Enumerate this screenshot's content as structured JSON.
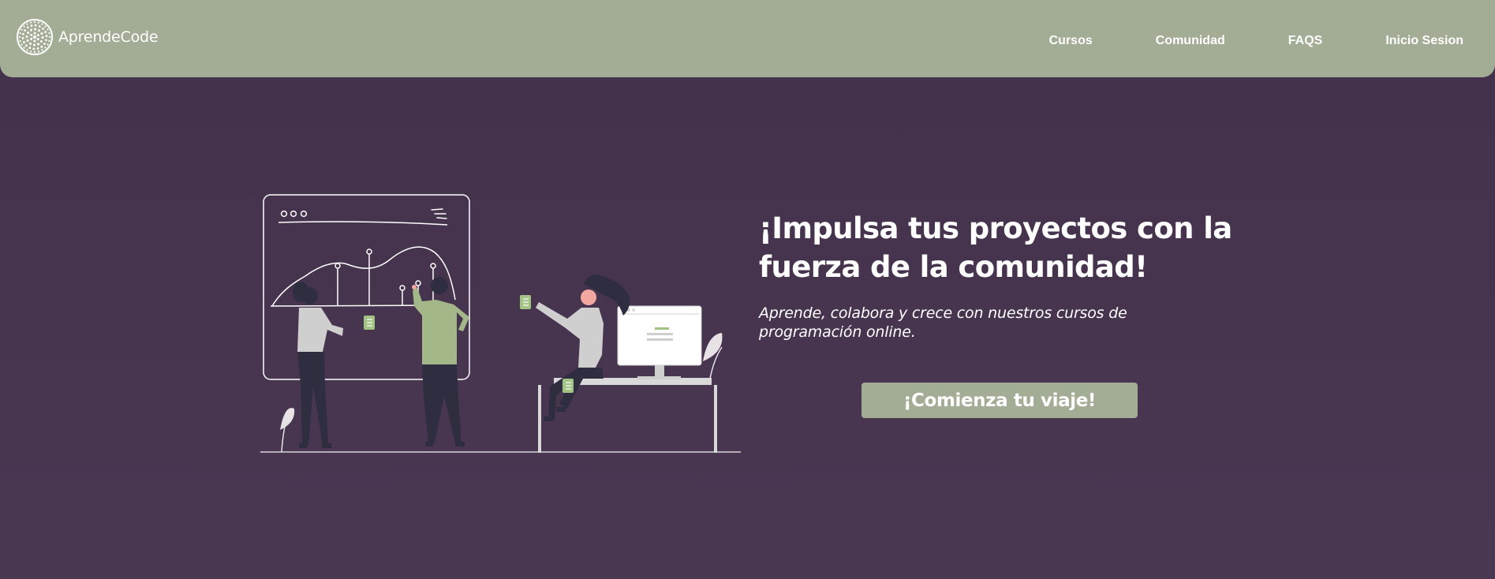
{
  "header": {
    "logo_text": "AprendeCode",
    "logo_icon": "circular-dots-logo",
    "nav": {
      "cursos": "Cursos",
      "comunidad": "Comunidad",
      "faqs": "FAQS",
      "login": "Inicio Sesion"
    }
  },
  "hero": {
    "title": "¡Impulsa tus proyectos con la fuerza de la comunidad!",
    "subtitle": "Aprende, colabora y crece con nuestros cursos de programación online.",
    "cta_label": "¡Comienza tu viaje!"
  },
  "colors": {
    "header_bg": "#a3ac94",
    "page_bg": "#43304a",
    "accent": "#a3ac94",
    "text": "#ffffff"
  }
}
